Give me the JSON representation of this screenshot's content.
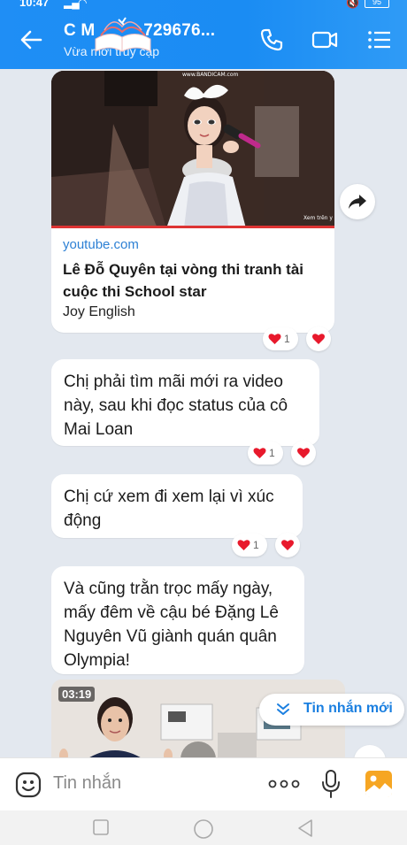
{
  "status_bar": {
    "time": "10:47",
    "battery": "95"
  },
  "header": {
    "contact_name": "C M          729676...",
    "status": "Vừa mới truy cập"
  },
  "link_card": {
    "watermark": "www.BANDICAM.com",
    "corner_text": "Xem trên y",
    "domain": "youtube.com",
    "title": "Lê Đỗ Quyên tại vòng thi tranh tài cuộc thi School star",
    "source": "Joy English",
    "reaction_count": "1"
  },
  "messages": [
    {
      "text": "Chị phải tìm mãi mới ra video này, sau khi đọc status của cô Mai Loan",
      "reaction_count": "1"
    },
    {
      "text": "Chị cứ xem đi xem lại vì xúc động",
      "reaction_count": "1"
    },
    {
      "text": "Và cũng  trằn trọc mấy ngày, mấy đêm về cậu bé Đặng Lê Nguyên Vũ giành quán quân Olympia!"
    }
  ],
  "video_card": {
    "duration": "03:19"
  },
  "new_messages_label": "Tin nhắn mới",
  "input": {
    "placeholder": "Tin nhắn"
  },
  "colors": {
    "header": "#1a8cf3",
    "link": "#2d80d4",
    "heart": "#e8192c",
    "accent": "#1a7fe0"
  }
}
